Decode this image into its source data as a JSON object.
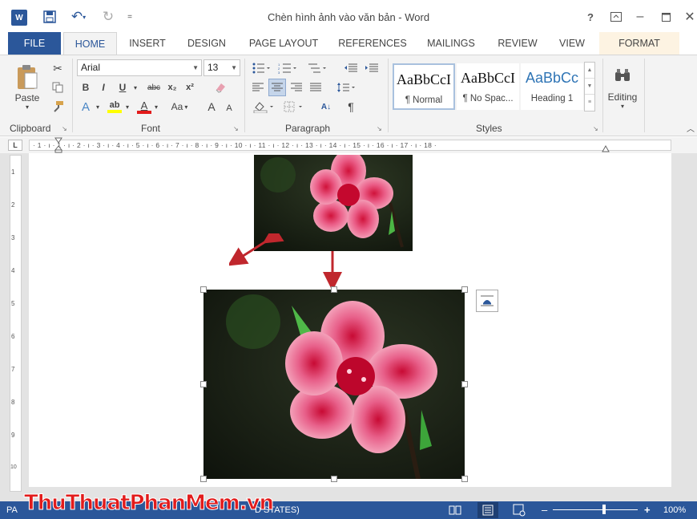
{
  "window": {
    "title": "Chèn hình ảnh vào văn bản - Word",
    "help_label": "?",
    "app_icon_label": "W"
  },
  "tabs": [
    {
      "label": "FILE"
    },
    {
      "label": "HOME"
    },
    {
      "label": "INSERT"
    },
    {
      "label": "DESIGN"
    },
    {
      "label": "PAGE LAYOUT"
    },
    {
      "label": "REFERENCES"
    },
    {
      "label": "MAILINGS"
    },
    {
      "label": "REVIEW"
    },
    {
      "label": "VIEW"
    },
    {
      "label": "FORMAT"
    }
  ],
  "clipboard": {
    "group_label": "Clipboard",
    "paste_label": "Paste"
  },
  "font": {
    "group_label": "Font",
    "font_name": "Arial",
    "font_size": "13",
    "bold": "B",
    "italic": "I",
    "underline": "U",
    "strikethrough": "abc",
    "subscript": "x₂",
    "superscript": "x²",
    "text_effects": "A",
    "highlight": "ab",
    "font_color": "A",
    "change_case": "Aa",
    "grow": "A",
    "shrink": "A"
  },
  "paragraph": {
    "group_label": "Paragraph",
    "sort": "A↓",
    "show_marks": "¶"
  },
  "styles": {
    "group_label": "Styles",
    "items": [
      {
        "sample": "AaBbCcI",
        "name": "¶ Normal"
      },
      {
        "sample": "AaBbCcI",
        "name": "¶ No Spac..."
      },
      {
        "sample": "AaBbCc",
        "name": "Heading 1"
      }
    ]
  },
  "editing": {
    "label": "Editing"
  },
  "ruler": {
    "marks": "· 1 · ı · 1 · ı · 2 · ı · 3 · ı · 4 · ı · 5 · ı · 6 · ı · 7 · ı · 8 · ı · 9 · ı · 10 · ı · 11 · ı · 12 · ı · 13 · ı · 14 · ı · 15 · ı · 16 · ı · 17 · ı · 18 ·",
    "tab_selector": "L",
    "vertical_marks": [
      "1",
      "2",
      "3",
      "4",
      "5",
      "6",
      "7",
      "8",
      "9",
      "10"
    ]
  },
  "statusbar": {
    "left_text": "PA",
    "states_text": "D STATES)",
    "zoom": "100%",
    "zoom_level_pct": 60,
    "minus": "–",
    "plus": "+"
  },
  "watermark": {
    "text": "ThuThuatPhanMem.vn"
  },
  "colors": {
    "accent": "#2b579a",
    "arrow": "#c0272d",
    "format_tab": "#fdf3e2",
    "watermark": "#e21b1b"
  }
}
